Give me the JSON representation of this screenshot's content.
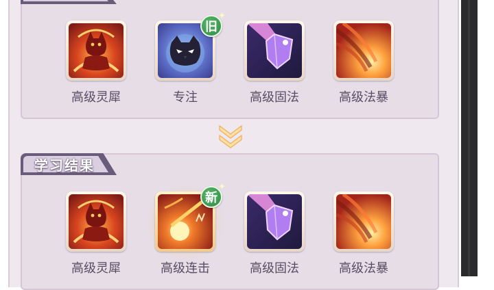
{
  "before": {
    "section_label": "",
    "skills": [
      {
        "name": "高级灵犀",
        "icon": "red-cat-meditation-icon"
      },
      {
        "name": "专注",
        "icon": "dark-owl-icon",
        "badge": "旧"
      },
      {
        "name": "高级固法",
        "icon": "purple-shield-icon"
      },
      {
        "name": "高级法暴",
        "icon": "fire-burst-icon"
      }
    ]
  },
  "arrow_icon": "double-chevron-down-icon",
  "after": {
    "section_label": "学习结果",
    "skills": [
      {
        "name": "高级灵犀",
        "icon": "red-cat-meditation-icon"
      },
      {
        "name": "高级连击",
        "icon": "fireball-icon",
        "badge": "新",
        "highlighted": true
      },
      {
        "name": "高级固法",
        "icon": "purple-shield-icon"
      },
      {
        "name": "高级法暴",
        "icon": "fire-burst-icon"
      }
    ]
  },
  "colors": {
    "badge_green": "#3a9a52",
    "label_text": "#5a4a63",
    "tab_purple": "#6b5b7a",
    "panel_bg": "#e6dde7"
  }
}
